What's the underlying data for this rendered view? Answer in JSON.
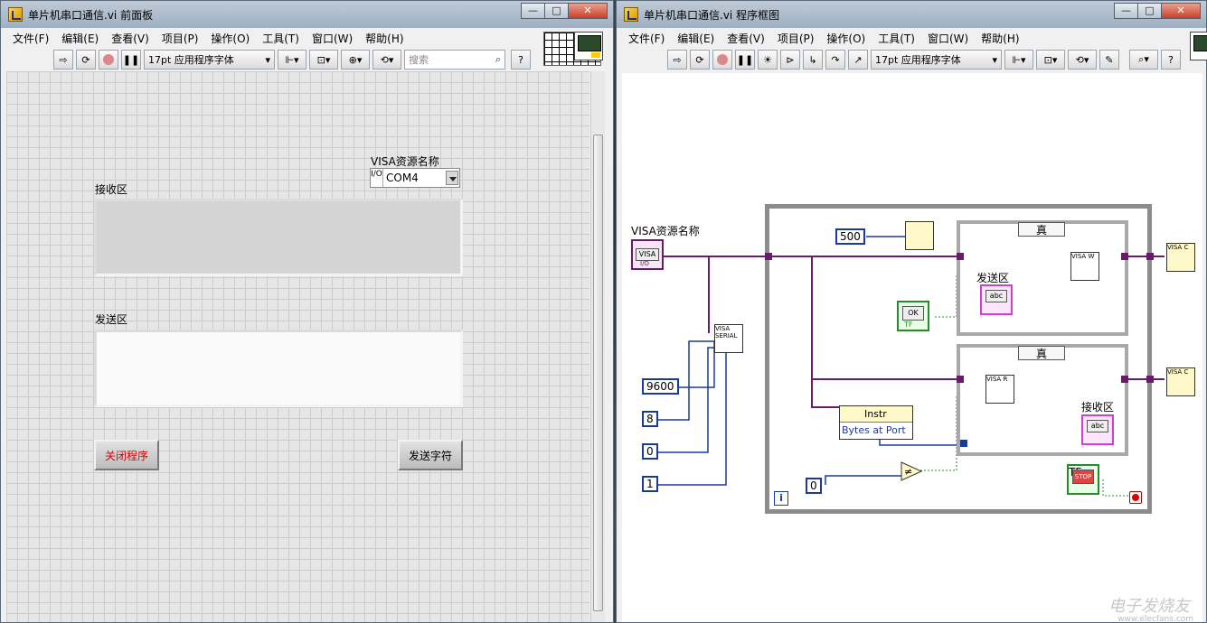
{
  "front_panel": {
    "title": "单片机串口通信.vi 前面板",
    "window_buttons": [
      "—",
      "□",
      "✕"
    ],
    "menu": [
      "文件(F)",
      "编辑(E)",
      "查看(V)",
      "项目(P)",
      "操作(O)",
      "工具(T)",
      "窗口(W)",
      "帮助(H)"
    ],
    "font_select": "17pt 应用程序字体",
    "search_placeholder": "搜索",
    "help_glyph": "?",
    "visa_label": "VISA资源名称",
    "visa_io": "I/O",
    "visa_value": "COM4",
    "recv_label": "接收区",
    "send_label": "发送区",
    "close_button": "关闭程序",
    "send_button": "发送字符"
  },
  "block_diagram": {
    "title": "单片机串口通信.vi 程序框图",
    "window_buttons": [
      "—",
      "□",
      "✕"
    ],
    "menu": [
      "文件(F)",
      "编辑(E)",
      "查看(V)",
      "项目(P)",
      "操作(O)",
      "工具(T)",
      "窗口(W)",
      "帮助(H)"
    ],
    "font_select": "17pt 应用程序字体",
    "visa_label": "VISA资源名称",
    "visa_term_text": "VISA",
    "visa_io": "I/O",
    "wait_ms": "500",
    "case1_selector": "真",
    "case2_selector": "真",
    "send_label": "发送区",
    "recv_label": "接收区",
    "abc": "abc",
    "ok_text": "OK",
    "tf": "TF",
    "baud": "9600",
    "data_bits": "8",
    "parity": "0",
    "stop_bits": "1",
    "zero": "0",
    "prop_class": "Instr",
    "prop_item": "Bytes at Port",
    "loop_i": "i",
    "stop_text": "STOP",
    "serial_vi": "VISA SERIAL",
    "write_vi": "VISA W",
    "read_vi": "VISA R",
    "close_vi": "VISA C",
    "neq": "≠"
  },
  "watermark": {
    "brand": "电子发烧友",
    "url": "www.elecfans.com"
  },
  "colors": {
    "visa_wire": "#6a1a6a",
    "int_wire": "#1a3a9a",
    "string_wire": "#d040d0",
    "bool_wire": "#2a8a2a"
  }
}
